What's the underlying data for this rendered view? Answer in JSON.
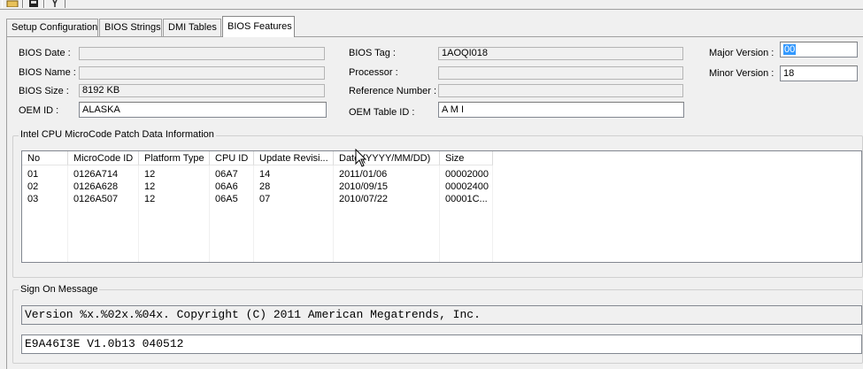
{
  "toolbar": {
    "buttons": [
      {
        "name": "open-icon"
      },
      {
        "name": "save-icon"
      },
      {
        "name": "tools-icon"
      }
    ]
  },
  "tabs": [
    {
      "label": "Setup Configuration",
      "active": false
    },
    {
      "label": "BIOS Strings",
      "active": false
    },
    {
      "label": "DMI Tables",
      "active": false
    },
    {
      "label": "BIOS Features",
      "active": true
    }
  ],
  "bios": {
    "date_label": "BIOS Date :",
    "date_value": "",
    "name_label": "BIOS Name :",
    "name_value": "",
    "size_label": "BIOS Size :",
    "size_value": "8192 KB",
    "oem_id_label": "OEM ID :",
    "oem_id_value": "ALASKA",
    "tag_label": "BIOS Tag :",
    "tag_value": "1AOQI018",
    "processor_label": "Processor :",
    "processor_value": "",
    "refnum_label": "Reference Number :",
    "refnum_value": "",
    "oem_table_label": "OEM Table ID :",
    "oem_table_value": "A M I",
    "major_label": "Major Version :",
    "major_value": "00",
    "minor_label": "Minor Version :",
    "minor_value": "18"
  },
  "microcode": {
    "title": "Intel CPU MicroCode Patch Data Information",
    "columns": [
      "No",
      "MicroCode ID",
      "Platform Type",
      "CPU ID",
      "Update Revisi...",
      "Date (YYYY/MM/DD)",
      "Size"
    ],
    "rows": [
      [
        "01",
        "0126A714",
        "12",
        "06A7",
        "14",
        "2011/01/06",
        "00002000"
      ],
      [
        "02",
        "0126A628",
        "12",
        "06A6",
        "28",
        "2010/09/15",
        "00002400"
      ],
      [
        "03",
        "0126A507",
        "12",
        "06A5",
        "07",
        "2010/07/22",
        "00001C..."
      ]
    ]
  },
  "signon": {
    "title": "Sign On Message",
    "line1": "Version %x.%02x.%04x. Copyright (C) 2011 American Megatrends, Inc.",
    "line2": "E9A46I3E V1.0b13 040512"
  }
}
